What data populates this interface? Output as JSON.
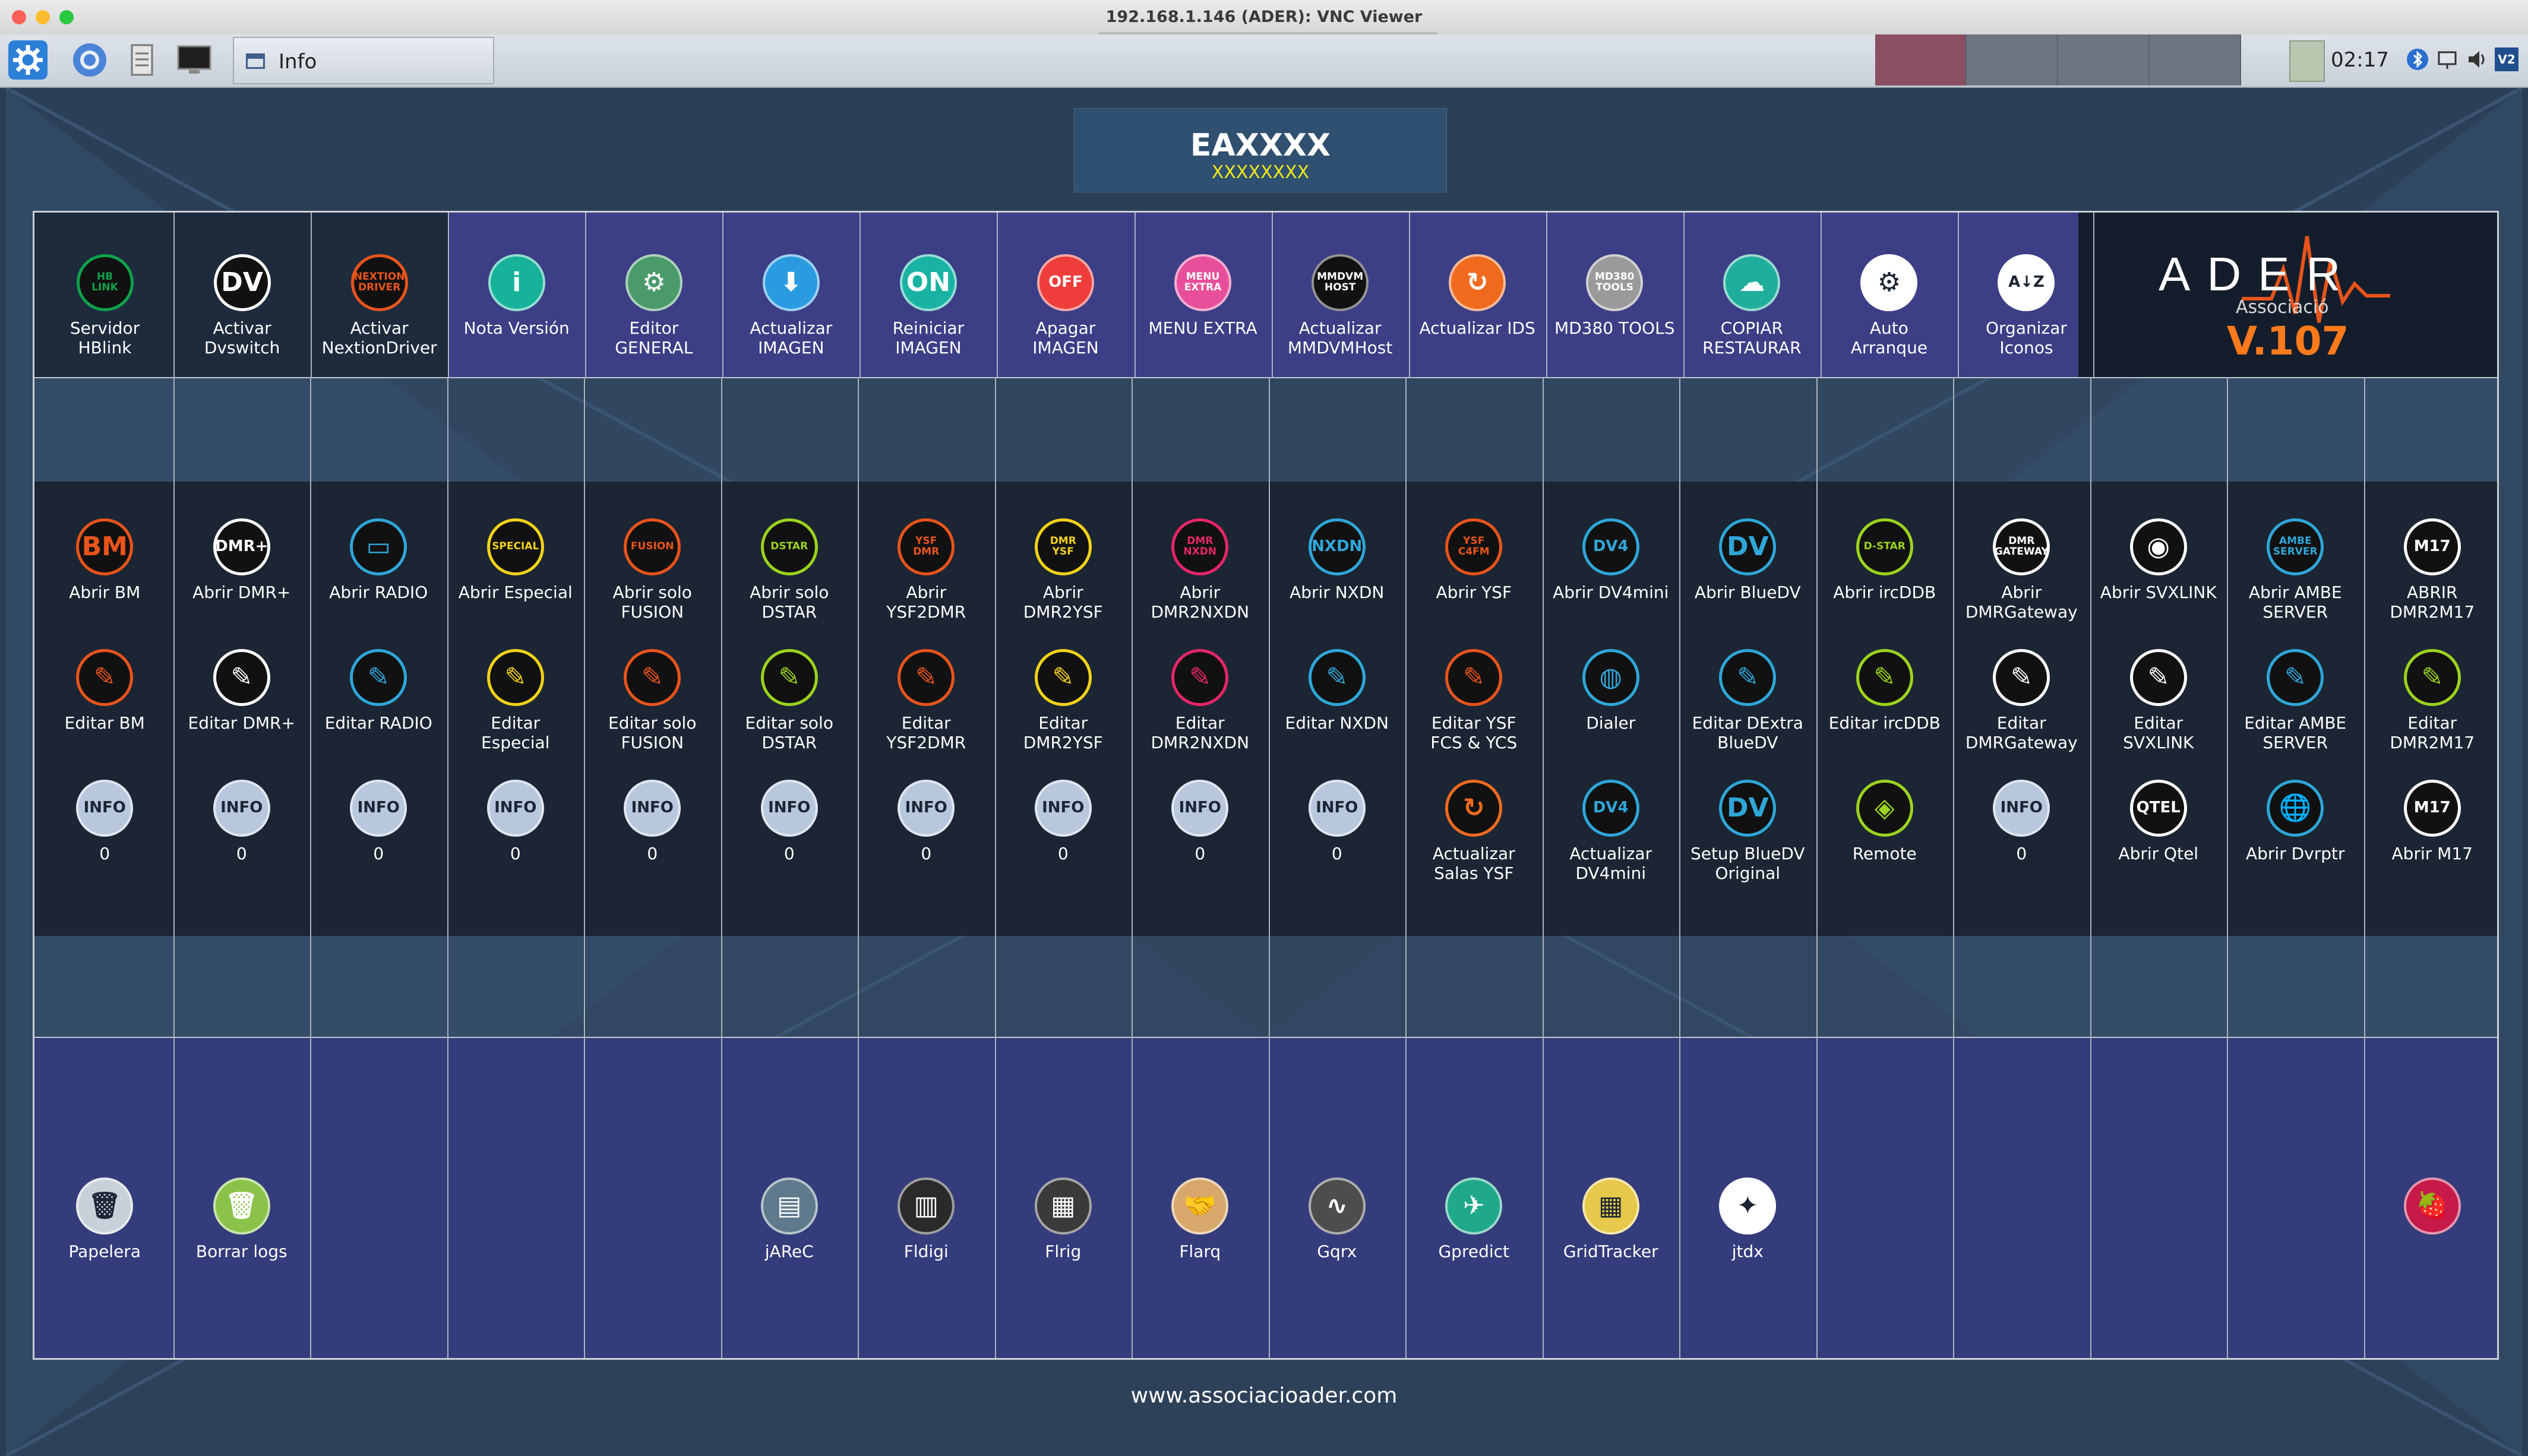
{
  "window": {
    "title": "192.168.1.146 (ADER): VNC Viewer"
  },
  "taskbar": {
    "active_window_label": "Info",
    "clock": "02:17",
    "icons": [
      "settings-icon",
      "browser-icon",
      "file-manager-icon",
      "terminal-icon"
    ]
  },
  "header": {
    "callsign": "EAXXXX",
    "subtitle": "XXXXXXXX"
  },
  "brand": {
    "name": "ADER",
    "subtitle": "Associació",
    "version": "V.107"
  },
  "top_row": [
    {
      "label": "Servidor\nHBlink",
      "badge": "HB\nLINK",
      "color": "#10a14a"
    },
    {
      "label": "Activar\nDvswitch",
      "badge": "DV",
      "color": "#ffffff"
    },
    {
      "label": "Activar\nNextionDriver",
      "badge": "NEXTION\nDRIVER",
      "color": "#e8541c"
    },
    {
      "label": "Nota Versión",
      "badge": "i",
      "color": "#16b39a"
    },
    {
      "label": "Editor\nGENERAL",
      "badge": "⚙",
      "color": "#4a9a6a"
    },
    {
      "label": "Actualizar\nIMAGEN",
      "badge": "⬇",
      "color": "#2a9be0"
    },
    {
      "label": "Reiniciar\nIMAGEN",
      "badge": "ON",
      "color": "#19b3a3"
    },
    {
      "label": "Apagar\nIMAGEN",
      "badge": "OFF",
      "color": "#ee3d3a"
    },
    {
      "label": "MENU EXTRA",
      "badge": "MENU\nEXTRA",
      "color": "#e84f9a"
    },
    {
      "label": "Actualizar\nMMDVMHost",
      "badge": "MMDVM\nHOST",
      "color": "#111111"
    },
    {
      "label": "Actualizar IDS",
      "badge": "↻",
      "color": "#f06a1e"
    },
    {
      "label": "MD380 TOOLS",
      "badge": "MD380\nTOOLS",
      "color": "#9a9a9a"
    },
    {
      "label": "COPIAR\nRESTAURAR",
      "badge": "☁",
      "color": "#1fae9c"
    },
    {
      "label": "Auto\nArranque",
      "badge": "⚙",
      "color": "#ffffff"
    },
    {
      "label": "Organizar\nIconos",
      "badge": "A↓Z",
      "color": "#ffffff"
    }
  ],
  "row_open": [
    {
      "label": "Abrir BM",
      "badge": "BM",
      "color": "#e8541c"
    },
    {
      "label": "Abrir DMR+",
      "badge": "DMR+",
      "color": "#ffffff"
    },
    {
      "label": "Abrir RADIO",
      "badge": "▭",
      "color": "#2fa6d8"
    },
    {
      "label": "Abrir Especial",
      "badge": "SPECIAL",
      "color": "#f2d21a"
    },
    {
      "label": "Abrir solo\nFUSION",
      "badge": "FUSION",
      "color": "#e8541c"
    },
    {
      "label": "Abrir solo\nDSTAR",
      "badge": "DSTAR",
      "color": "#9bd31e"
    },
    {
      "label": "Abrir\nYSF2DMR",
      "badge": "YSF\nDMR",
      "color": "#e8541c"
    },
    {
      "label": "Abrir\nDMR2YSF",
      "badge": "DMR\nYSF",
      "color": "#f2d21a"
    },
    {
      "label": "Abrir\nDMR2NXDN",
      "badge": "DMR\nNXDN",
      "color": "#e6266a"
    },
    {
      "label": "Abrir NXDN",
      "badge": "NXDN",
      "color": "#2fa6d8"
    },
    {
      "label": "Abrir YSF",
      "badge": "YSF\nC4FM",
      "color": "#e8541c"
    },
    {
      "label": "Abrir DV4mini",
      "badge": "DV4",
      "color": "#2fa6d8"
    },
    {
      "label": "Abrir BlueDV",
      "badge": "DV",
      "color": "#2fa6d8"
    },
    {
      "label": "Abrir ircDDB",
      "badge": "D-STAR",
      "color": "#9bd31e"
    },
    {
      "label": "Abrir\nDMRGateway",
      "badge": "DMR\nGATEWAY",
      "color": "#ffffff"
    },
    {
      "label": "Abrir SVXLINK",
      "badge": "◉",
      "color": "#ffffff"
    },
    {
      "label": "Abrir AMBE\nSERVER",
      "badge": "AMBE\nSERVER",
      "color": "#2fa6d8"
    },
    {
      "label": "ABRIR\nDMR2M17",
      "badge": "M17",
      "color": "#ffffff"
    }
  ],
  "row_edit": [
    {
      "label": "Editar BM",
      "badge": "✎",
      "color": "#e8541c"
    },
    {
      "label": "Editar DMR+",
      "badge": "✎",
      "color": "#ffffff"
    },
    {
      "label": "Editar RADIO",
      "badge": "✎",
      "color": "#2fa6d8"
    },
    {
      "label": "Editar\nEspecial",
      "badge": "✎",
      "color": "#f2d21a"
    },
    {
      "label": "Editar solo\nFUSION",
      "badge": "✎",
      "color": "#e8541c"
    },
    {
      "label": "Editar solo\nDSTAR",
      "badge": "✎",
      "color": "#9bd31e"
    },
    {
      "label": "Editar\nYSF2DMR",
      "badge": "✎",
      "color": "#e8541c"
    },
    {
      "label": "Editar\nDMR2YSF",
      "badge": "✎",
      "color": "#f2d21a"
    },
    {
      "label": "Editar\nDMR2NXDN",
      "badge": "✎",
      "color": "#e6266a"
    },
    {
      "label": "Editar NXDN",
      "badge": "✎",
      "color": "#2fa6d8"
    },
    {
      "label": "Editar YSF\nFCS & YCS",
      "badge": "✎",
      "color": "#e8541c"
    },
    {
      "label": "Dialer",
      "badge": "◍",
      "color": "#2fa6d8"
    },
    {
      "label": "Editar DExtra\nBlueDV",
      "badge": "✎",
      "color": "#2fa6d8"
    },
    {
      "label": "Editar ircDDB",
      "badge": "✎",
      "color": "#9bd31e"
    },
    {
      "label": "Editar\nDMRGateway",
      "badge": "✎",
      "color": "#ffffff"
    },
    {
      "label": "Editar\nSVXLINK",
      "badge": "✎",
      "color": "#ffffff"
    },
    {
      "label": "Editar AMBE\nSERVER",
      "badge": "✎",
      "color": "#2fa6d8"
    },
    {
      "label": "Editar\nDMR2M17",
      "badge": "✎",
      "color": "#9bd31e"
    }
  ],
  "row_info": [
    {
      "label": "0",
      "badge": "INFO",
      "color": "#b9c7dd"
    },
    {
      "label": "0",
      "badge": "INFO",
      "color": "#b9c7dd"
    },
    {
      "label": "0",
      "badge": "INFO",
      "color": "#b9c7dd"
    },
    {
      "label": "0",
      "badge": "INFO",
      "color": "#b9c7dd"
    },
    {
      "label": "0",
      "badge": "INFO",
      "color": "#b9c7dd"
    },
    {
      "label": "0",
      "badge": "INFO",
      "color": "#b9c7dd"
    },
    {
      "label": "0",
      "badge": "INFO",
      "color": "#b9c7dd"
    },
    {
      "label": "0",
      "badge": "INFO",
      "color": "#b9c7dd"
    },
    {
      "label": "0",
      "badge": "INFO",
      "color": "#b9c7dd"
    },
    {
      "label": "0",
      "badge": "INFO",
      "color": "#b9c7dd"
    },
    {
      "label": "Actualizar\nSalas YSF",
      "badge": "↻",
      "color": "#f06a1e"
    },
    {
      "label": "Actualizar\nDV4mini",
      "badge": "DV4",
      "color": "#2fa6d8"
    },
    {
      "label": "Setup BlueDV\nOriginal",
      "badge": "DV",
      "color": "#2fa6d8"
    },
    {
      "label": "Remote",
      "badge": "◈",
      "color": "#9bd31e"
    },
    {
      "label": "0",
      "badge": "INFO",
      "color": "#b9c7dd"
    },
    {
      "label": "Abrir Qtel",
      "badge": "QTEL",
      "color": "#ffffff"
    },
    {
      "label": "Abrir Dvrptr",
      "badge": "🌐",
      "color": "#2fa6d8"
    },
    {
      "label": "Abrir M17",
      "badge": "M17",
      "color": "#ffffff"
    }
  ],
  "bottom_row": [
    {
      "col": 0,
      "label": "Papelera",
      "badge": "🗑",
      "color": "#c8d0da"
    },
    {
      "col": 1,
      "label": "Borrar logs",
      "badge": "🗑",
      "color": "#8bc34a"
    },
    {
      "col": 5,
      "label": "jAReC",
      "badge": "▤",
      "color": "#5e7a8c"
    },
    {
      "col": 6,
      "label": "Fldigi",
      "badge": "▥",
      "color": "#2a2a2a"
    },
    {
      "col": 7,
      "label": "Flrig",
      "badge": "▦",
      "color": "#3a3a3a"
    },
    {
      "col": 8,
      "label": "Flarq",
      "badge": "🤝",
      "color": "#d7a76c"
    },
    {
      "col": 9,
      "label": "Gqrx",
      "badge": "∿",
      "color": "#4d4d4d"
    },
    {
      "col": 10,
      "label": "Gpredict",
      "badge": "✈",
      "color": "#1fa98a"
    },
    {
      "col": 11,
      "label": "GridTracker",
      "badge": "▦",
      "color": "#e6c84a"
    },
    {
      "col": 12,
      "label": "jtdx",
      "badge": "✦",
      "color": "#ffffff"
    },
    {
      "col": 17,
      "label": "",
      "badge": "🍓",
      "color": "#c51a4a"
    }
  ],
  "footer": {
    "url": "www.associacioader.com"
  }
}
